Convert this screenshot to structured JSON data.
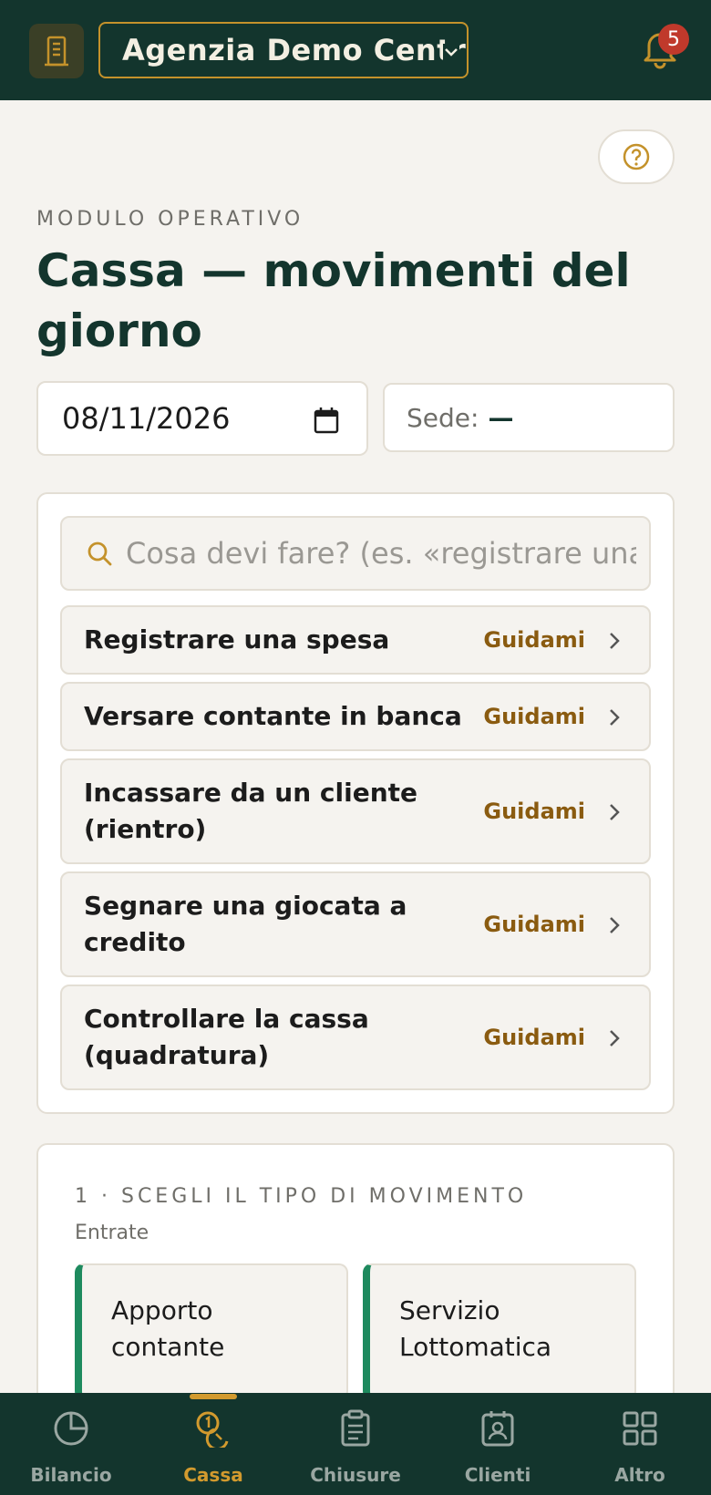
{
  "header": {
    "agency_name": "Agenzia Demo Centro",
    "notification_count": "5"
  },
  "page": {
    "eyebrow": "MODULO OPERATIVO",
    "title": "Cassa — movimenti del giorno"
  },
  "filters": {
    "date_value": "08/11/2026",
    "sede_label": "Sede:",
    "sede_value": "—"
  },
  "quick_actions": {
    "search_placeholder": "Cosa devi fare? (es. «registrare una spesa»)",
    "guide_label": "Guidami",
    "items": [
      {
        "label": "Registrare una spesa"
      },
      {
        "label": "Versare contante in banca"
      },
      {
        "label": "Incassare da un cliente (rientro)"
      },
      {
        "label": "Segnare una giocata a credito"
      },
      {
        "label": "Controllare la cassa (quadratura)"
      }
    ]
  },
  "movement": {
    "step_label": "1 · SCEGLI IL TIPO DI MOVIMENTO",
    "group_label": "Entrate",
    "types": [
      {
        "label": "Apporto contante"
      },
      {
        "label": "Servizio Lottomatica"
      }
    ]
  },
  "bottom_nav": {
    "active": "Cassa",
    "items": [
      {
        "label": "Bilancio",
        "icon": "pie-chart-icon"
      },
      {
        "label": "Cassa",
        "icon": "coins-icon"
      },
      {
        "label": "Chiusure",
        "icon": "clipboard-icon"
      },
      {
        "label": "Clienti",
        "icon": "contact-card-icon"
      },
      {
        "label": "Altro",
        "icon": "grid-icon"
      }
    ]
  },
  "colors": {
    "brand_dark": "#13352d",
    "accent_gold": "#c4922b",
    "income_green": "#1e8a5e",
    "badge_red": "#c0392b"
  }
}
